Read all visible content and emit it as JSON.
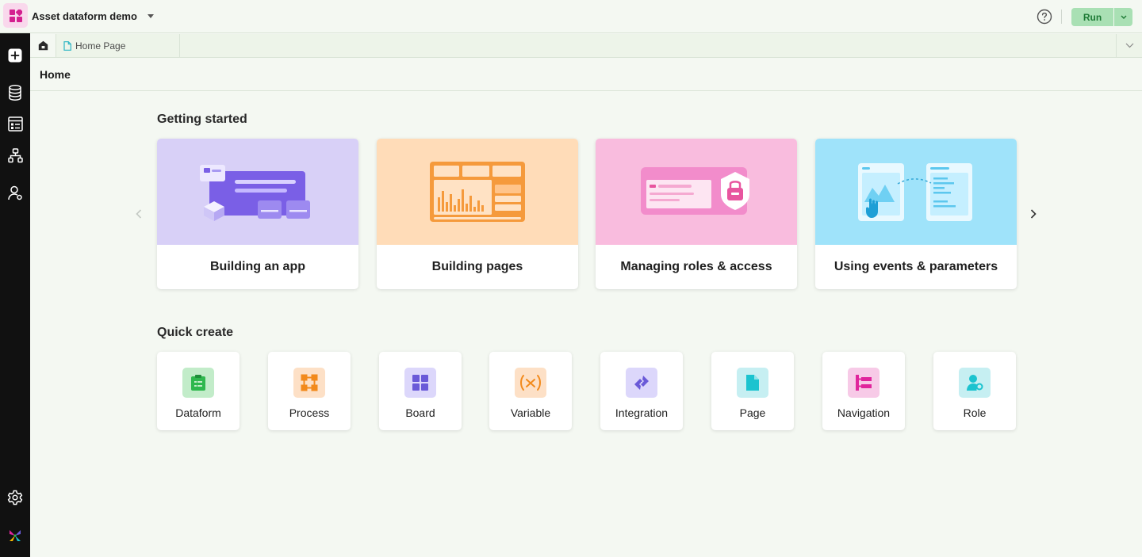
{
  "app": {
    "name": "Asset dataform demo"
  },
  "topbar": {
    "run_label": "Run"
  },
  "tabs": {
    "page_tab_label": "Home Page"
  },
  "page": {
    "title": "Home"
  },
  "getting_started": {
    "title": "Getting started",
    "cards": [
      {
        "label": "Building an app",
        "bg": "#d8d0f7"
      },
      {
        "label": "Building pages",
        "bg": "#ffdcb8"
      },
      {
        "label": "Managing roles & access",
        "bg": "#f9bcde"
      },
      {
        "label": "Using events & parameters",
        "bg": "#9fe3fa"
      }
    ]
  },
  "quick_create": {
    "title": "Quick create",
    "items": [
      {
        "label": "Dataform",
        "icon": "dataform-icon",
        "bg": "#c2ecc9",
        "fg": "#2fb84e"
      },
      {
        "label": "Process",
        "icon": "process-icon",
        "bg": "#fde0c6",
        "fg": "#f28a1c"
      },
      {
        "label": "Board",
        "icon": "board-icon",
        "bg": "#dcd7fb",
        "fg": "#6a5ad8"
      },
      {
        "label": "Variable",
        "icon": "variable-icon",
        "bg": "#fde0c6",
        "fg": "#f28a1c"
      },
      {
        "label": "Integration",
        "icon": "integration-icon",
        "bg": "#dcd7fb",
        "fg": "#6a5ad8"
      },
      {
        "label": "Page",
        "icon": "page-icon",
        "bg": "#c6eff2",
        "fg": "#1bc3cf"
      },
      {
        "label": "Navigation",
        "icon": "navigation-icon",
        "bg": "#f7cae7",
        "fg": "#e0259c"
      },
      {
        "label": "Role",
        "icon": "role-icon",
        "bg": "#c6eff2",
        "fg": "#1bc3cf"
      }
    ]
  }
}
